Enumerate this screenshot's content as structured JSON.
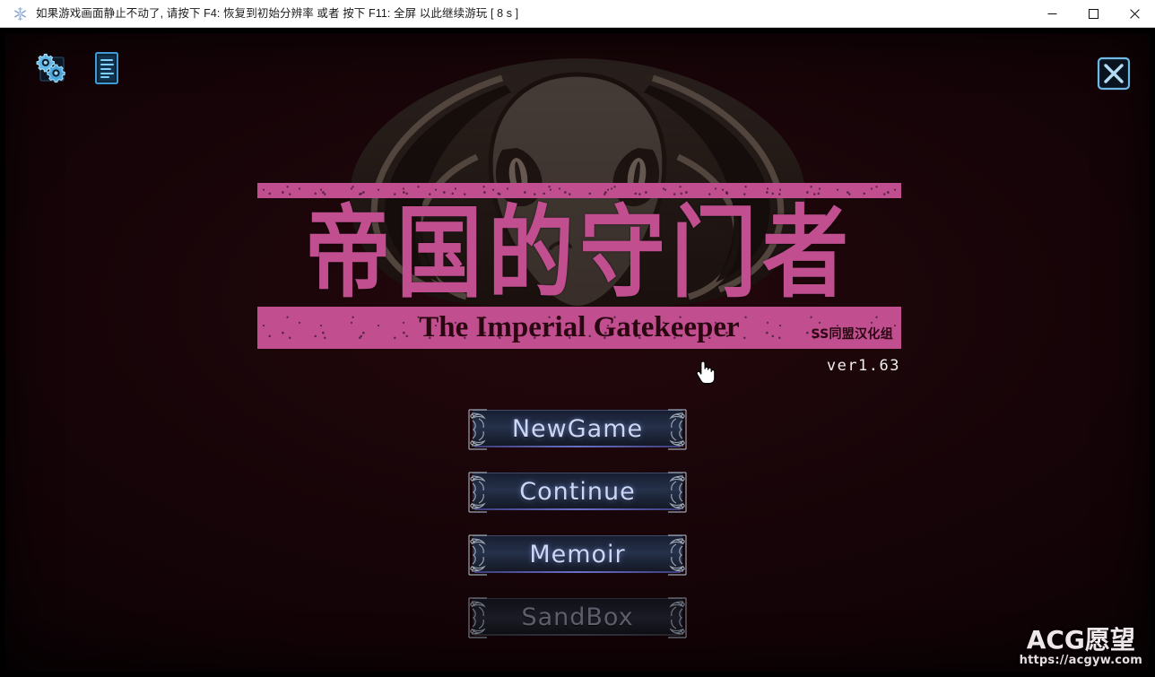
{
  "window": {
    "titlebar": {
      "icon": "snowflake-icon",
      "message": "如果游戏画面静止不动了, 请按下 F4: 恢复到初始分辨率 或者 按下 F11: 全屏 以此继续游玩 [ 8 s ]",
      "minimize_label": "minimize-icon",
      "maximize_label": "maximize-icon",
      "close_label": "close-icon"
    }
  },
  "game": {
    "background_art": "cobra-snake-head",
    "tools": [
      {
        "id": "settings",
        "icon": "gears-settings-icon"
      },
      {
        "id": "notes",
        "icon": "document-notes-icon"
      }
    ],
    "close_button": {
      "icon": "close-x-icon"
    },
    "logo": {
      "title_cn": "帝国的守门者",
      "title_en": "The Imperial Gatekeeper",
      "credit": "SS同盟汉化组",
      "band_color": "#c14f90"
    },
    "version": "ver1.63",
    "cursor": "pointing-hand-cursor",
    "menu": [
      {
        "id": "newgame",
        "label": "NewGame",
        "disabled": false
      },
      {
        "id": "continue",
        "label": "Continue",
        "disabled": false
      },
      {
        "id": "memoir",
        "label": "Memoir",
        "disabled": false
      },
      {
        "id": "sandbox",
        "label": "SandBox",
        "disabled": true
      }
    ],
    "watermark": {
      "name": "ACG愿望",
      "url": "https://acgyw.com"
    }
  },
  "colors": {
    "background": "#190509",
    "accent_pink": "#c14f90",
    "button_text": "#ccd6f5",
    "disabled_text": "#5c5f6b",
    "icon_blue": "#7fc4f0"
  }
}
